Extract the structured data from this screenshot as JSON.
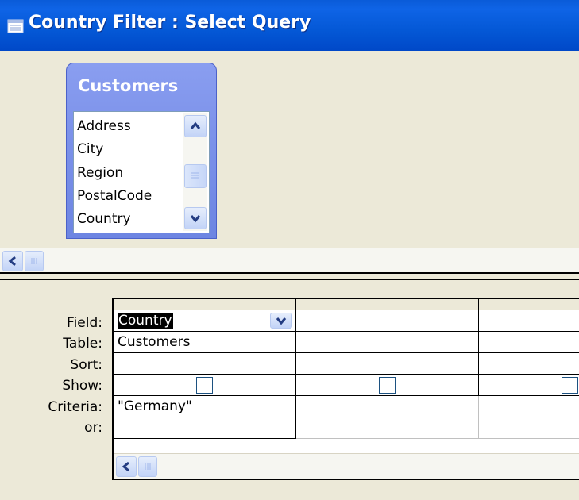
{
  "window": {
    "title": "Country Filter : Select Query"
  },
  "table": {
    "name": "Customers",
    "fields": [
      "Address",
      "City",
      "Region",
      "PostalCode",
      "Country"
    ]
  },
  "grid": {
    "row_labels": {
      "field": "Field:",
      "table": "Table:",
      "sort": "Sort:",
      "show": "Show:",
      "criteria": "Criteria:",
      "or": "or:"
    },
    "columns": [
      {
        "field": "Country",
        "table": "Customers",
        "sort": "",
        "criteria": "\"Germany\"",
        "or": ""
      }
    ]
  },
  "colors": {
    "titlebar": "#0458d6",
    "table_header": "#7c92ea",
    "background": "#ece9d8"
  }
}
